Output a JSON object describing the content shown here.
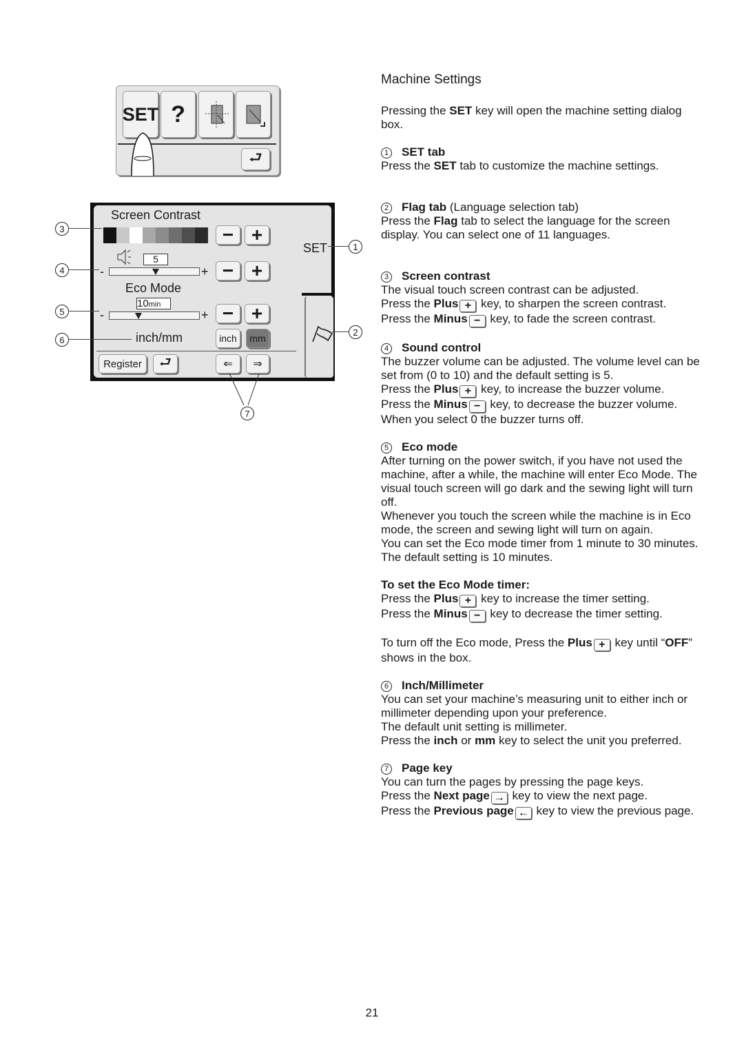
{
  "diagram": {
    "top_keys": [
      "SET",
      "?"
    ],
    "panel": {
      "screen_contrast_label": "Screen Contrast",
      "volume_value": "5",
      "eco_mode_label": "Eco Mode",
      "eco_value": "10",
      "eco_unit": "min",
      "unit_label": "inch/mm",
      "inch_button": "inch",
      "mm_button": "mm",
      "register_button": "Register",
      "set_tab": "SET",
      "minus": "−",
      "plus": "+",
      "selected_unit": "mm",
      "contrast_swatches": [
        "#111111",
        "#c8c8c8",
        "#ffffff",
        "#a8a8a8",
        "#8c8c8c",
        "#6e6e6e",
        "#4e4e4e",
        "#2a2a2a"
      ]
    },
    "callouts": [
      "1",
      "2",
      "3",
      "4",
      "5",
      "6",
      "7"
    ]
  },
  "text": {
    "title": "Machine Settings",
    "blocks": [
      {
        "paras": [
          [
            {
              "t": "Pressing the "
            },
            {
              "t": "SET",
              "b": 1
            },
            {
              "t": " key will open the machine setting dialog box."
            }
          ]
        ]
      },
      {
        "num": "1",
        "head": [
          {
            "t": "SET tab",
            "b": 1
          }
        ],
        "paras": [
          [
            {
              "t": "Press the "
            },
            {
              "t": "SET",
              "b": 1
            },
            {
              "t": " tab to customize the machine settings."
            }
          ]
        ],
        "gap": 1
      },
      {
        "num": "2",
        "head": [
          {
            "t": "Flag tab",
            "b": 1
          },
          {
            "t": " (Language selection tab)"
          }
        ],
        "paras": [
          [
            {
              "t": "Press the "
            },
            {
              "t": "Flag",
              "b": 1
            },
            {
              "t": " tab to select the language for the screen display. You can select one of 11 languages."
            }
          ]
        ],
        "gap": 1
      },
      {
        "num": "3",
        "head": [
          {
            "t": "Screen contrast",
            "b": 1
          }
        ],
        "paras": [
          [
            {
              "t": "The visual touch screen contrast can be adjusted."
            }
          ],
          [
            {
              "t": "Press the "
            },
            {
              "t": "Plus",
              "b": 1
            },
            {
              "k": "+"
            },
            {
              "t": " key, to sharpen the screen contrast."
            }
          ],
          [
            {
              "t": "Press the "
            },
            {
              "t": "Minus",
              "b": 1
            },
            {
              "k": "−"
            },
            {
              "t": " key, to fade the screen contrast."
            }
          ]
        ]
      },
      {
        "num": "4",
        "head": [
          {
            "t": "Sound control",
            "b": 1
          }
        ],
        "paras": [
          [
            {
              "t": "The buzzer volume can be adjusted. The volume level can be set from (0 to 10) and the default setting is 5."
            }
          ],
          [
            {
              "t": "Press the "
            },
            {
              "t": "Plus",
              "b": 1
            },
            {
              "k": "+"
            },
            {
              "t": " key, to increase the buzzer volume."
            }
          ],
          [
            {
              "t": "Press the "
            },
            {
              "t": "Minus",
              "b": 1
            },
            {
              "k": "−"
            },
            {
              "t": " key, to decrease the buzzer volume."
            }
          ],
          [
            {
              "t": "When you select 0 the buzzer turns off."
            }
          ]
        ]
      },
      {
        "num": "5",
        "head": [
          {
            "t": "Eco mode",
            "b": 1
          }
        ],
        "paras": [
          [
            {
              "t": "After turning on the power switch, if you have not used the machine, after a while, the machine will enter Eco Mode. The visual touch screen will go dark and the sewing light will turn off."
            }
          ],
          [
            {
              "t": "Whenever you touch the screen while the machine is in Eco mode, the screen and sewing light will turn on again."
            }
          ],
          [
            {
              "t": "You can set the Eco mode timer from 1 minute to 30 minutes. The default setting is 10 minutes."
            }
          ]
        ]
      },
      {
        "head": [
          {
            "t": "To set the Eco Mode timer:",
            "b": 1
          }
        ],
        "paras": [
          [
            {
              "t": "Press the "
            },
            {
              "t": "Plus",
              "b": 1
            },
            {
              "k": "+"
            },
            {
              "t": " key to increase the timer setting."
            }
          ],
          [
            {
              "t": "Press the "
            },
            {
              "t": "Minus",
              "b": 1
            },
            {
              "k": "−"
            },
            {
              "t": " key to decrease the timer setting."
            }
          ]
        ]
      },
      {
        "paras": [
          [
            {
              "t": "To turn off the Eco mode, Press the "
            },
            {
              "t": "Plus",
              "b": 1
            },
            {
              "k": "+"
            },
            {
              "t": " key until “"
            },
            {
              "t": "OFF",
              "b": 1
            },
            {
              "t": "” shows in the box."
            }
          ]
        ]
      },
      {
        "num": "6",
        "head": [
          {
            "t": "Inch/Millimeter",
            "b": 1
          }
        ],
        "paras": [
          [
            {
              "t": "You can set your machine’s measuring unit to either inch or millimeter depending upon your preference."
            }
          ],
          [
            {
              "t": "The default unit setting is millimeter."
            }
          ],
          [
            {
              "t": "Press the "
            },
            {
              "t": "inch",
              "b": 1
            },
            {
              "t": " or "
            },
            {
              "t": "mm",
              "b": 1
            },
            {
              "t": " key to select the unit you preferred."
            }
          ]
        ]
      },
      {
        "num": "7",
        "head": [
          {
            "t": "Page key",
            "b": 1
          }
        ],
        "paras": [
          [
            {
              "t": "You can turn the pages by pressing the page keys."
            }
          ],
          [
            {
              "t": "Press the "
            },
            {
              "t": "Next page",
              "b": 1
            },
            {
              "k": "→"
            },
            {
              "t": " key to view the next page."
            }
          ],
          [
            {
              "t": "Press the "
            },
            {
              "t": "Previous page",
              "b": 1
            },
            {
              "k": "←"
            },
            {
              "t": " key to view the previous page."
            }
          ]
        ]
      }
    ]
  },
  "page_number": "21"
}
